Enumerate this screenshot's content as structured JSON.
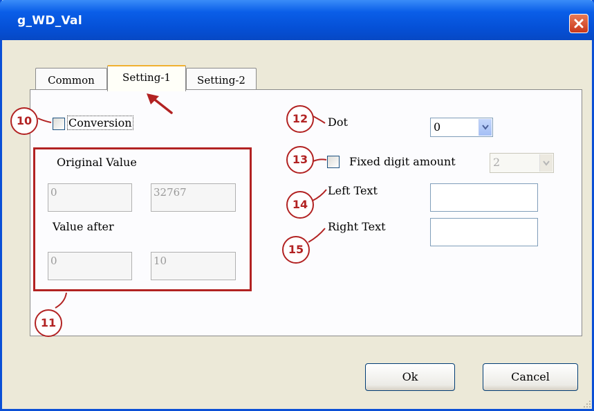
{
  "window": {
    "title": "g_WD_Val"
  },
  "tabs": [
    {
      "label": "Common"
    },
    {
      "label": "Setting-1",
      "selected": true
    },
    {
      "label": "Setting-2"
    }
  ],
  "conversion": {
    "label": "Conversion",
    "checked": false
  },
  "group": {
    "original_label": "Original Value",
    "original_min": "0",
    "original_max": "32767",
    "after_label": "Value after",
    "after_min": "0",
    "after_max": "10"
  },
  "dot": {
    "label": "Dot",
    "value": "0"
  },
  "fixed_digit": {
    "label": "Fixed digit amount",
    "checked": false,
    "value": "2"
  },
  "left_text": {
    "label": "Left Text",
    "value": ""
  },
  "right_text": {
    "label": "Right Text",
    "value": ""
  },
  "callouts": [
    "10",
    "11",
    "12",
    "13",
    "14",
    "15"
  ],
  "buttons": {
    "ok": "Ok",
    "cancel": "Cancel"
  },
  "colors": {
    "titlebar": "#0550d6",
    "callout": "#b22222",
    "dialog_bg": "#ece9d8"
  },
  "icons": [
    "close-icon",
    "dropdown-arrow-icon",
    "arrow-pointer-icon",
    "resize-grip-icon"
  ]
}
